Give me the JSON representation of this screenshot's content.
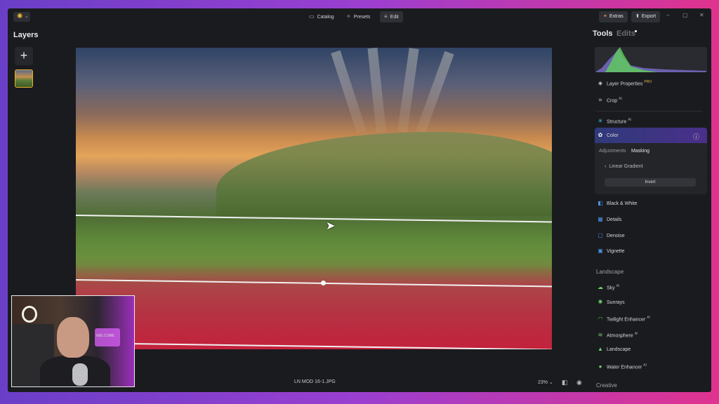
{
  "topbar": {
    "nav": [
      {
        "label": "Catalog",
        "icon": "folder-icon"
      },
      {
        "label": "Presets",
        "icon": "sparkle-icon"
      },
      {
        "label": "Edit",
        "icon": "sliders-icon"
      }
    ],
    "extras_label": "Extras",
    "export_label": "Export"
  },
  "left": {
    "title": "Layers"
  },
  "canvas": {
    "filename": "LN MOD 16-1.JPG",
    "zoom": "23%"
  },
  "right": {
    "tools_label": "Tools",
    "edits_label": "Edits",
    "items_top": [
      {
        "label": "Layer Properties",
        "badge": "PRO"
      },
      {
        "label": "Crop",
        "badge": "AI"
      }
    ],
    "structure": {
      "label": "Structure",
      "badge": "AI"
    },
    "color": {
      "label": "Color",
      "tabs": [
        "Adjustments",
        "Masking"
      ],
      "linear_gradient": "Linear Gradient",
      "invert": "Invert"
    },
    "items_mid": [
      {
        "label": "Black & White"
      },
      {
        "label": "Details"
      },
      {
        "label": "Denoise"
      },
      {
        "label": "Vignette"
      }
    ],
    "landscape_heading": "Landscape",
    "landscape_items": [
      {
        "label": "Sky",
        "badge": "AI"
      },
      {
        "label": "Sunrays"
      },
      {
        "label": "Twilight Enhancer",
        "badge": "AI"
      },
      {
        "label": "Atmosphere",
        "badge": "AI"
      },
      {
        "label": "Landscape"
      },
      {
        "label": "Water Enhancer",
        "badge": "AI"
      }
    ],
    "creative_heading": "Creative"
  },
  "webcam": {
    "sign_text": "WELCOME"
  }
}
